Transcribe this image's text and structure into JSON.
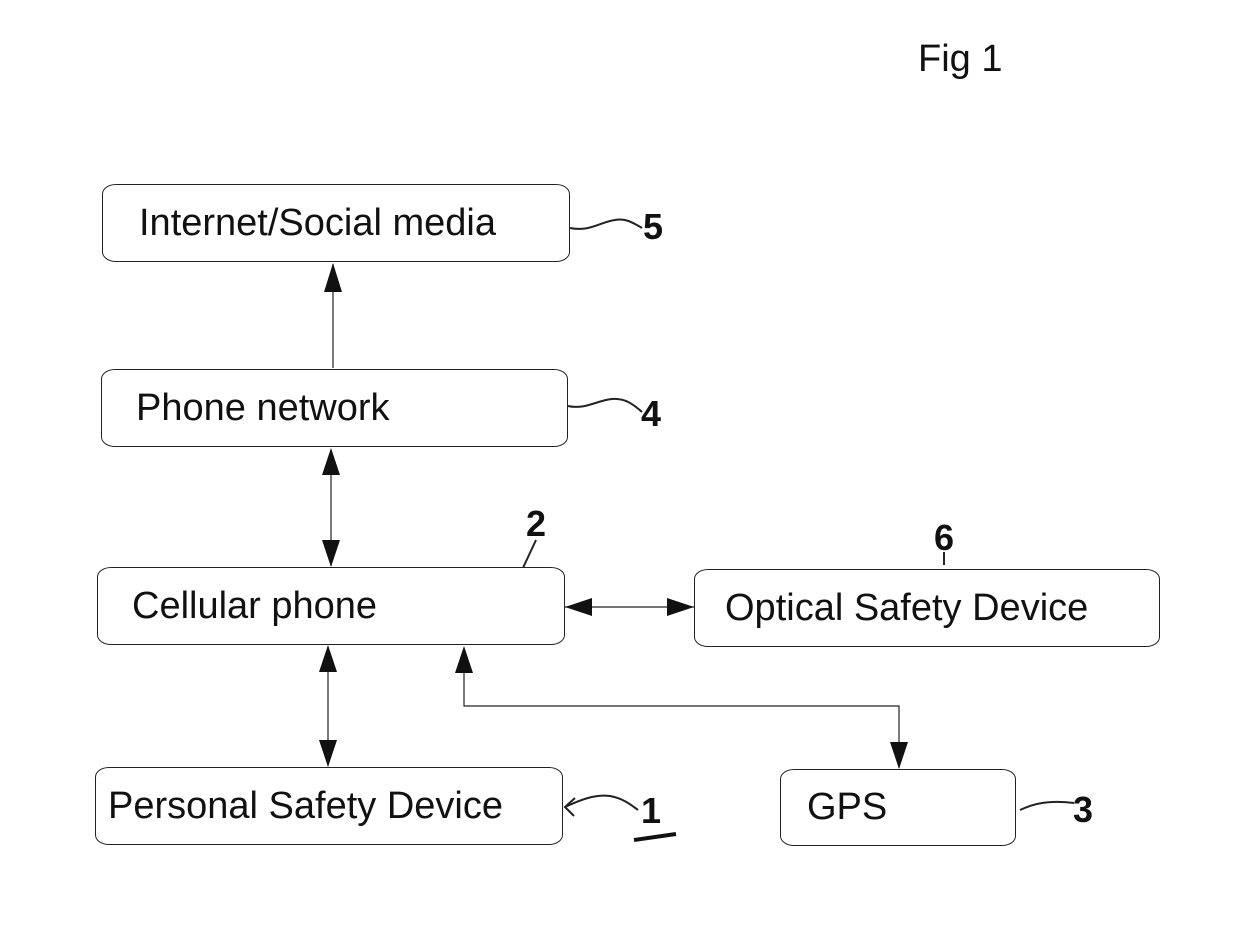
{
  "figure": {
    "title": "Fig 1"
  },
  "nodes": [
    {
      "id": "internet",
      "label": "Internet/Social media",
      "ref": "5"
    },
    {
      "id": "phone_network",
      "label": "Phone network",
      "ref": "4"
    },
    {
      "id": "cellular_phone",
      "label": "Cellular phone",
      "ref": "2"
    },
    {
      "id": "optical_safety_device",
      "label": "Optical Safety Device",
      "ref": "6"
    },
    {
      "id": "personal_safety_device",
      "label": "Personal Safety Device",
      "ref": "1"
    },
    {
      "id": "gps",
      "label": "GPS",
      "ref": "3"
    }
  ],
  "edges": [
    {
      "from": "phone_network",
      "to": "internet",
      "direction": "one-way"
    },
    {
      "from": "cellular_phone",
      "to": "phone_network",
      "direction": "two-way"
    },
    {
      "from": "cellular_phone",
      "to": "optical_safety_device",
      "direction": "two-way"
    },
    {
      "from": "cellular_phone",
      "to": "personal_safety_device",
      "direction": "two-way"
    },
    {
      "from": "cellular_phone",
      "to": "gps",
      "direction": "two-way"
    }
  ]
}
